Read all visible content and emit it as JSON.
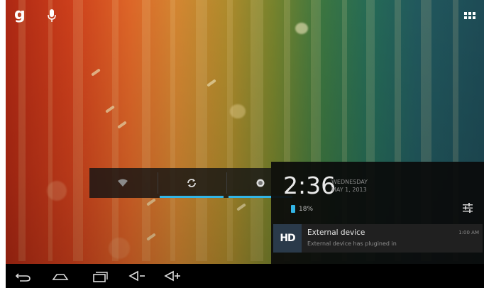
{
  "status_bar": {
    "google_search_glyph": "g",
    "icons": [
      "google-search-icon",
      "microphone-icon",
      "all-apps-icon"
    ]
  },
  "quick_settings": {
    "buttons": [
      {
        "name": "wifi-icon",
        "active": false
      },
      {
        "name": "sync-icon",
        "active": true
      },
      {
        "name": "brightness-icon",
        "active": true
      }
    ]
  },
  "notification_panel": {
    "time": "2:36",
    "day": "WEDNESDAY",
    "date": "MAY 1, 2013",
    "battery_percent": "18%",
    "settings_icon": "settings-sliders-icon",
    "notifications": [
      {
        "icon_label": "HD",
        "title": "External device",
        "text": "External device has plugined in",
        "time": "1:00 AM"
      }
    ]
  },
  "nav_bar": {
    "buttons": [
      "back-icon",
      "home-icon",
      "recent-apps-icon",
      "volume-down-icon",
      "volume-up-icon"
    ]
  },
  "colors": {
    "accent": "#33b5e5",
    "panel_bg": "#0a0a0a",
    "notification_bg": "#202020"
  }
}
